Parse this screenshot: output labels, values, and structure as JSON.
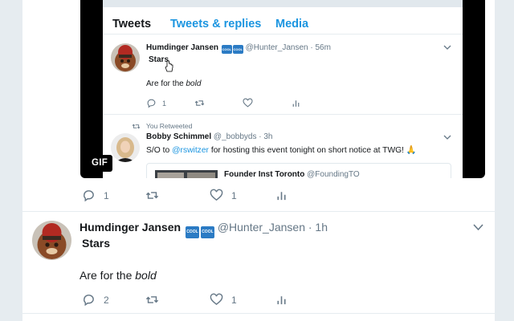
{
  "gif": {
    "badge": "GIF",
    "tabs": [
      "Tweets",
      "Tweets & replies",
      "Media"
    ],
    "tweet1": {
      "name": "Humdinger Jansen",
      "badges": [
        "COOL",
        "COOL"
      ],
      "handle": "@Hunter_Jansen",
      "time": "· 56m",
      "stars": "Stars",
      "text_prefix": "Are for the ",
      "text_em": "bold",
      "reply_count": "1"
    },
    "retweet": {
      "label": "You Retweeted",
      "name": "Bobby Schimmel",
      "handle": "@_bobbyds",
      "time": "· 3h",
      "text_before": "S/O to ",
      "mention": "@rswitzer",
      "text_after": " for hosting this event tonight on short notice at TWG! 🙏",
      "quote_title": "Founder Inst Toronto",
      "quote_handle": "@FoundingTO"
    }
  },
  "first_actions": {
    "reply_count": "1",
    "like_count": "1"
  },
  "tweet": {
    "name": "Humdinger Jansen",
    "badges": [
      "COOL",
      "COOL"
    ],
    "handle": "@Hunter_Jansen",
    "time": "· 1h",
    "stars": "Stars",
    "text_prefix": "Are for the ",
    "text_em": "bold",
    "reply_count": "2",
    "like_count": "1"
  },
  "colors": {
    "accent": "#1b95e0",
    "background": "#e6ecf0",
    "muted": "#657786",
    "badge": "#2b7bc4"
  },
  "icons": [
    "reply-icon",
    "retweet-icon",
    "like-icon",
    "analytics-icon",
    "chevron-down-icon",
    "hand-cursor-icon"
  ]
}
